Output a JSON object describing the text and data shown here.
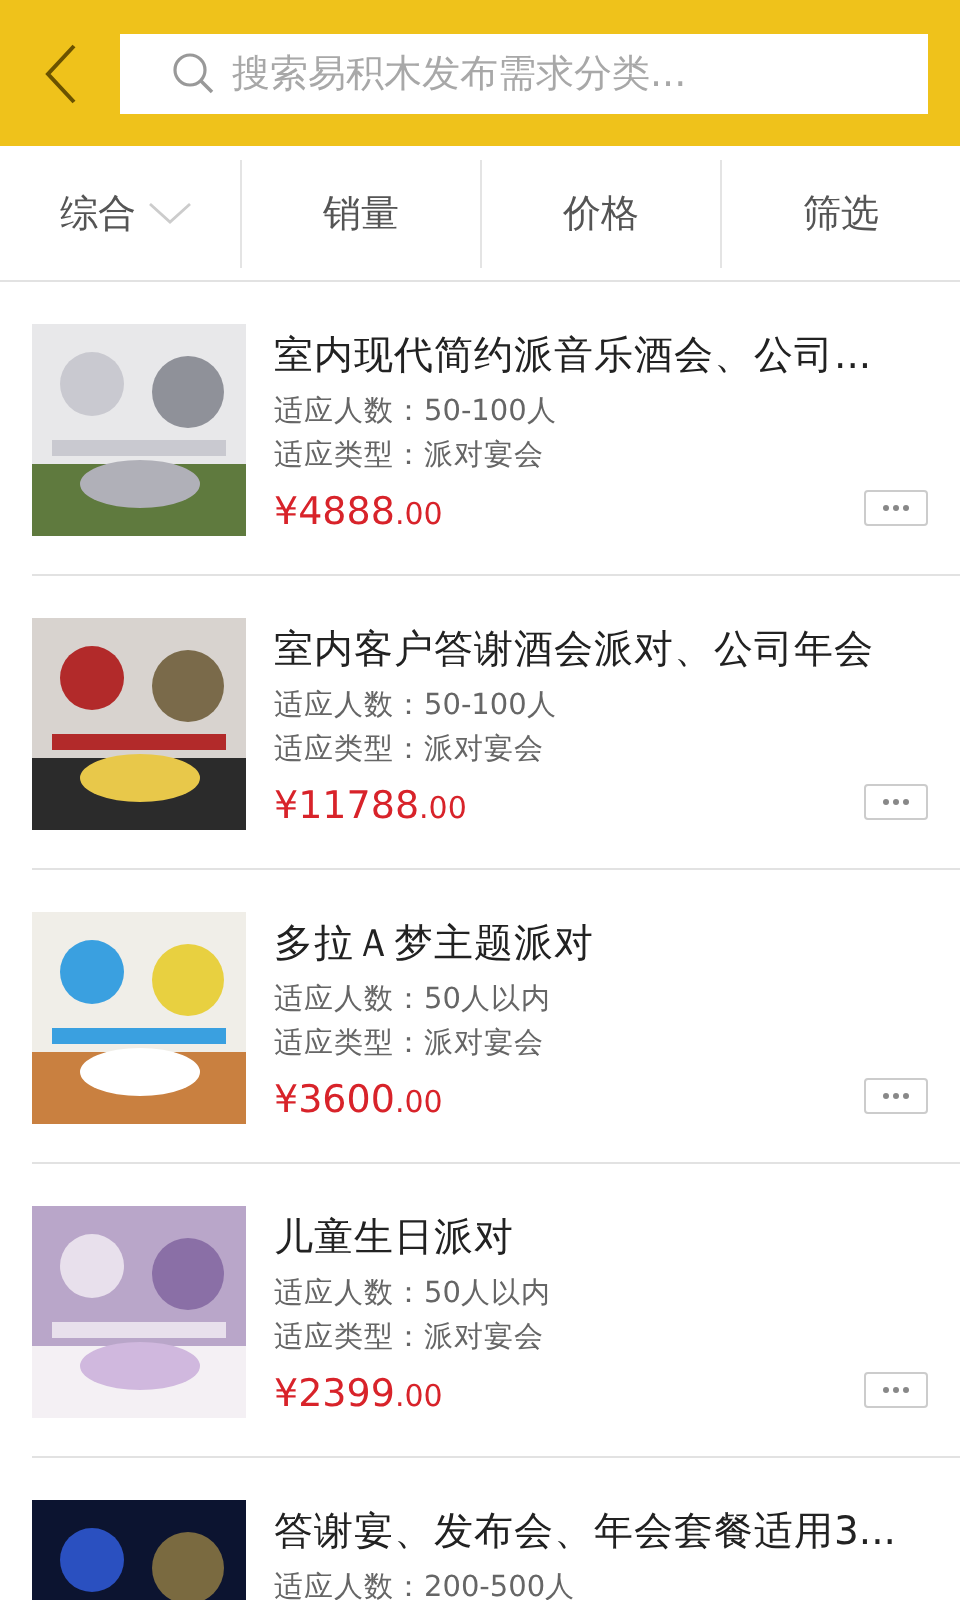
{
  "search": {
    "placeholder": "搜索易积木发布需求分类..."
  },
  "sort_tabs": [
    {
      "label": "综合",
      "dropdown": true
    },
    {
      "label": "销量"
    },
    {
      "label": "价格"
    },
    {
      "label": "筛选"
    }
  ],
  "products": [
    {
      "kind": "picture",
      "title": "室内现代简约派音乐酒会、公司...",
      "capacity": "适应人数：50-100人",
      "type": "适应类型：派对宴会",
      "price": "¥4888",
      "cents": ".00"
    },
    {
      "kind": "picture",
      "title": "室内客户答谢酒会派对、公司年会",
      "capacity": "适应人数：50-100人",
      "type": "适应类型：派对宴会",
      "price": "¥11788",
      "cents": ".00"
    },
    {
      "kind": "picture",
      "title": "多拉Ａ梦主题派对",
      "capacity": "适应人数：50人以内",
      "type": "适应类型：派对宴会",
      "price": "¥3600",
      "cents": ".00"
    },
    {
      "kind": "picture",
      "title": "儿童生日派对",
      "capacity": "适应人数：50人以内",
      "type": "适应类型：派对宴会",
      "price": "¥2399",
      "cents": ".00"
    },
    {
      "kind": "picture",
      "title": "答谢宴、发布会、年会套餐适用3...",
      "capacity": "适应人数：200-500人"
    }
  ]
}
